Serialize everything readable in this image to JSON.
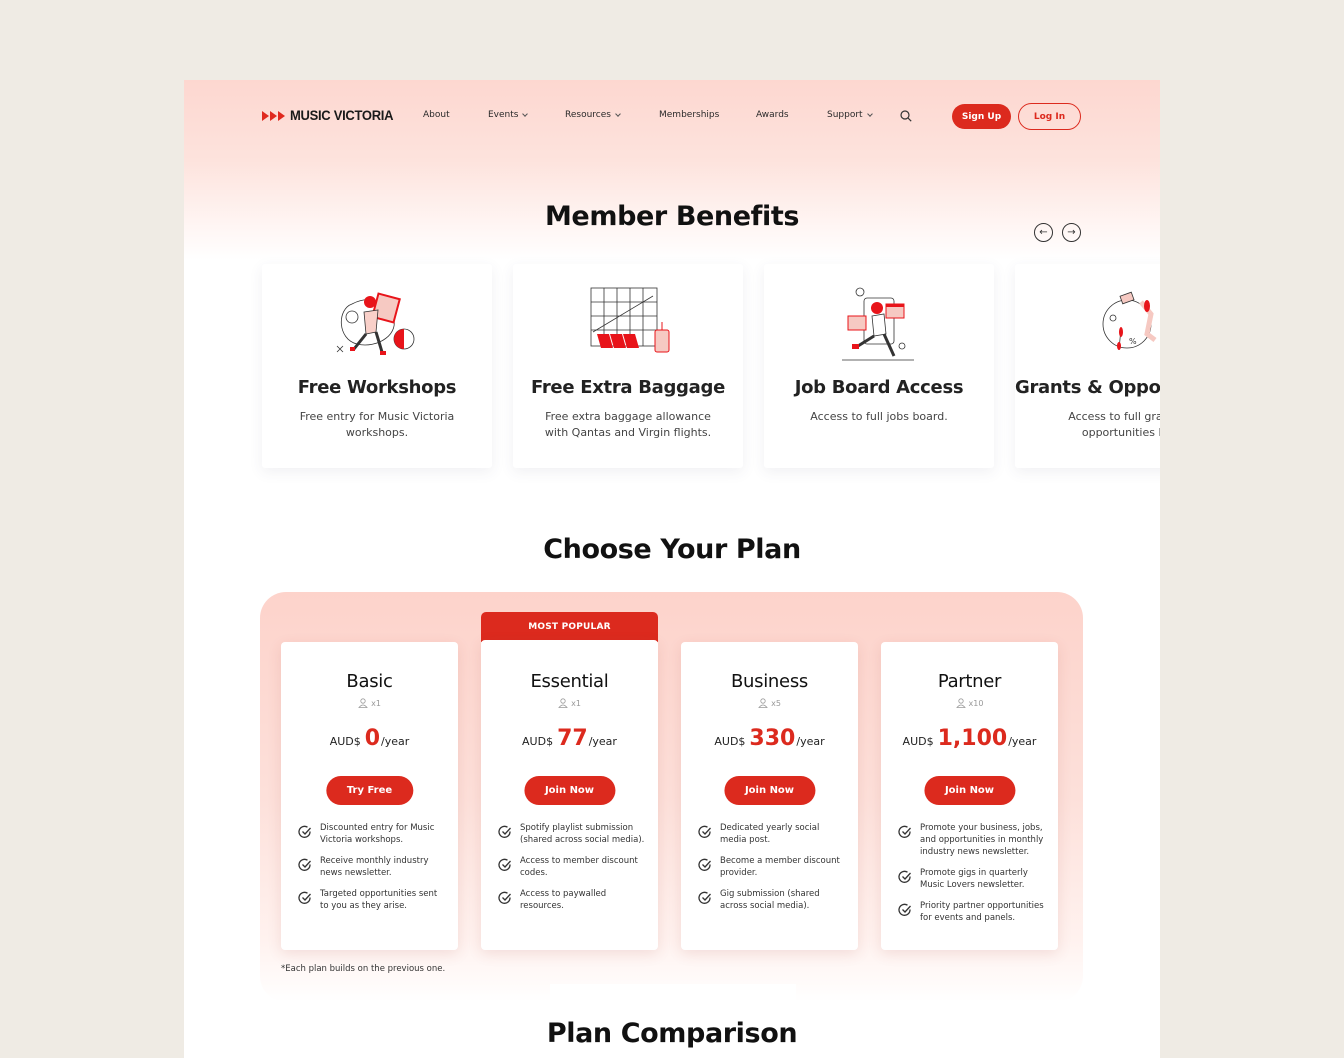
{
  "brand": {
    "name": "MUSIC VICTORIA",
    "accent_color": "#dc2a1e",
    "logo_icon": "triple-play-chevron-icon"
  },
  "nav": {
    "items": [
      {
        "label": "About",
        "has_dropdown": false
      },
      {
        "label": "Events",
        "has_dropdown": true
      },
      {
        "label": "Resources",
        "has_dropdown": true
      },
      {
        "label": "Memberships",
        "has_dropdown": false
      },
      {
        "label": "Awards",
        "has_dropdown": false
      },
      {
        "label": "Support",
        "has_dropdown": true
      }
    ],
    "search_icon": "search-icon",
    "signup_label": "Sign Up",
    "login_label": "Log In"
  },
  "benefits": {
    "title": "Member Benefits",
    "prev_icon": "arrow-left-circle-icon",
    "next_icon": "arrow-right-circle-icon",
    "prev_glyph": "←",
    "next_glyph": "→",
    "cards": [
      {
        "title": "Free Workshops",
        "description": "Free entry for Music Victoria workshops.",
        "illustration": "workshop-illustration"
      },
      {
        "title": "Free Extra Baggage",
        "description": "Free extra baggage allowance with Qantas and Virgin flights.",
        "illustration": "airport-illustration"
      },
      {
        "title": "Job Board Access",
        "description": "Access to full jobs board.",
        "illustration": "job-board-illustration"
      },
      {
        "title": "Grants & Opportunities",
        "description": "Access to full grants & opportunities list.",
        "illustration": "grants-illustration"
      }
    ]
  },
  "plans": {
    "title": "Choose Your Plan",
    "popular_label": "MOST POPULAR",
    "currency": "AUD$",
    "period": "/year",
    "items": [
      {
        "name": "Basic",
        "users": "x1",
        "price": "0",
        "cta": "Try Free",
        "features": [
          "Discounted entry for Music Victoria workshops.",
          "Receive monthly industry news newsletter.",
          "Targeted opportunities sent to you as they arise."
        ]
      },
      {
        "name": "Essential",
        "users": "x1",
        "price": "77",
        "cta": "Join Now",
        "popular": true,
        "features": [
          "Spotify playlist submission (shared across social media).",
          "Access to member discount codes.",
          "Access to paywalled resources."
        ]
      },
      {
        "name": "Business",
        "users": "x5",
        "price": "330",
        "cta": "Join Now",
        "features": [
          "Dedicated yearly social media post.",
          "Become a member discount provider.",
          "Gig submission (shared across social media)."
        ]
      },
      {
        "name": "Partner",
        "users": "x10",
        "price": "1,100",
        "cta": "Join Now",
        "features": [
          "Promote your business, jobs, and opportunities in monthly industry news newsletter.",
          "Promote gigs in quarterly Music Lovers newsletter.",
          "Priority partner opportunities for events and panels."
        ]
      }
    ],
    "footnote": "*Each plan builds on the previous one."
  },
  "comparison": {
    "title": "Plan Comparison"
  }
}
